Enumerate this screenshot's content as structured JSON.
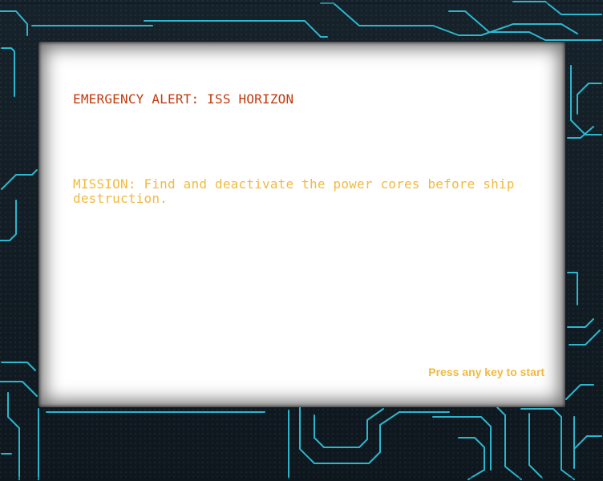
{
  "game": {
    "alert_title": "EMERGENCY ALERT: ISS HORIZON",
    "mission_text": "MISSION: Find and deactivate the power cores before ship destruction.",
    "start_prompt": "Press any key to start"
  },
  "colors": {
    "alert": "#c23a0e",
    "mission": "#f2b93d",
    "prompt": "#f2b93d",
    "frame": "#121c24",
    "circuit": "#2fc8e0",
    "screen": "#ffffff"
  }
}
